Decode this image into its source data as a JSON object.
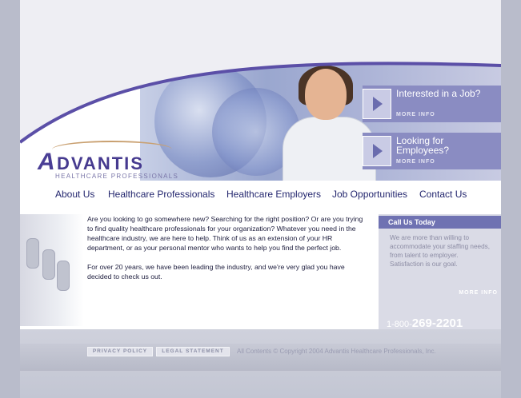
{
  "header": {
    "logo_text": "DVANTIS",
    "logo_mark": "A",
    "logo_subtitle": "HEALTHCARE PROFESSIONALS"
  },
  "promos": [
    {
      "title": "Interested in a Job?",
      "more": "MORE INFO"
    },
    {
      "title": "Looking for Employees?",
      "more": "MORE INFO"
    }
  ],
  "nav": {
    "items": [
      "About Us",
      "Healthcare Professionals",
      "Healthcare Employers",
      "Job Opportunities",
      "Contact Us"
    ]
  },
  "main": {
    "paragraph1": "Are you looking to go somewhere new? Searching for the right position? Or are you trying to find quality healthcare professionals for your organization? Whatever you need in the healthcare industry, we are here to help. Think of us as an extension of your HR department, or as your personal mentor who wants to help you find the perfect job.",
    "paragraph2": "For over 20 years, we have been leading the industry, and we're very glad you have decided to check us out."
  },
  "callbox": {
    "title": "Call Us Today",
    "body": "We are more than willing to accommodate your staffing needs, from talent to employer. Satisfaction is our goal.",
    "more": "MORE INFO",
    "phone_prefix": "1-800-",
    "phone_number": "269-2201"
  },
  "footer": {
    "privacy": "PRIVACY POLICY",
    "legal": "LEGAL STATEMENT",
    "copyright": "All Contents © Copyright 2004 Advantis Healthcare Professionals, Inc."
  },
  "colors": {
    "brand": "#463a8f",
    "nav_text": "#23266e",
    "promo_bg": "#8a8cc2",
    "frame": "#b9bccb"
  }
}
